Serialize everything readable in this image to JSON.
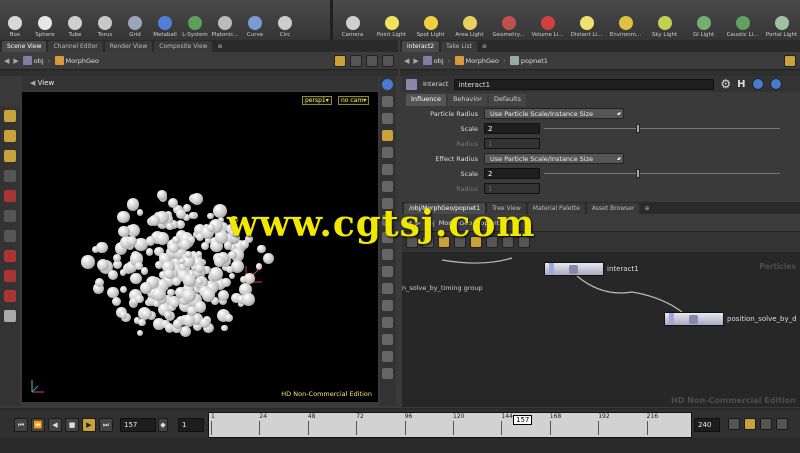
{
  "shelf_left": [
    {
      "label": "Box",
      "icon": "box-icon",
      "color": "#d8d8d8"
    },
    {
      "label": "Sphere",
      "icon": "sphere-icon",
      "color": "#e6e6e6"
    },
    {
      "label": "Tube",
      "icon": "tube-icon",
      "color": "#cfcfcf"
    },
    {
      "label": "Torus",
      "icon": "torus-icon",
      "color": "#c8c8c8"
    },
    {
      "label": "Grid",
      "icon": "grid-icon",
      "color": "#9aa6b8"
    },
    {
      "label": "Metaball",
      "icon": "metaball-icon",
      "color": "#4f7fd8"
    },
    {
      "label": "L-System",
      "icon": "lsystem-icon",
      "color": "#5aa05a"
    },
    {
      "label": "Platonic...",
      "icon": "platonic-icon",
      "color": "#bbbbbb"
    },
    {
      "label": "Curve",
      "icon": "curve-icon",
      "color": "#7a9ad0"
    },
    {
      "label": "Circ",
      "icon": "circle-icon",
      "color": "#cccccc"
    }
  ],
  "shelf_right": [
    {
      "label": "Camera",
      "icon": "camera-icon",
      "color": "#cfcfcf"
    },
    {
      "label": "Point Light",
      "icon": "point-light-icon",
      "color": "#f2e25c"
    },
    {
      "label": "Spot Light",
      "icon": "spot-light-icon",
      "color": "#f0d040"
    },
    {
      "label": "Area Light",
      "icon": "area-light-icon",
      "color": "#e8d060"
    },
    {
      "label": "Geometry...",
      "icon": "geometry-light-icon",
      "color": "#c05050"
    },
    {
      "label": "Volume Li...",
      "icon": "volume-light-icon",
      "color": "#d04040"
    },
    {
      "label": "Distant Li...",
      "icon": "distant-light-icon",
      "color": "#f0e070"
    },
    {
      "label": "Environm...",
      "icon": "environment-light-icon",
      "color": "#e0c040"
    },
    {
      "label": "Sky Light",
      "icon": "sky-light-icon",
      "color": "#c0d050"
    },
    {
      "label": "GI Light",
      "icon": "gi-light-icon",
      "color": "#70b070"
    },
    {
      "label": "Caustic Li...",
      "icon": "caustic-light-icon",
      "color": "#60a060"
    },
    {
      "label": "Portal Light",
      "icon": "portal-light-icon",
      "color": "#a0c0a0"
    }
  ],
  "left_pane": {
    "tabs": [
      "Scene View",
      "Channel Editor",
      "Render View",
      "Composite View"
    ],
    "path": {
      "root": "obj",
      "node": "MorphGeo"
    },
    "view_title": "View",
    "persp_label": "persp1▾",
    "cam_label": "no cam▾",
    "edition": "HD Non-Commercial Edition"
  },
  "param_pane": {
    "tabs": [
      "interact2",
      "Take List"
    ],
    "path": {
      "root": "obj",
      "node": "MorphGeo",
      "leaf": "popnet1"
    },
    "node_type": "Interact",
    "node_name": "interact1",
    "param_tabs": [
      "Influence",
      "Behavior",
      "Defaults"
    ],
    "rows": [
      {
        "label": "Particle Radius",
        "menu": "Use Particle Scale/Instance Size"
      },
      {
        "label": "Scale",
        "value": "2"
      },
      {
        "label": "Radius",
        "value": "1"
      },
      {
        "label": "Effect Radius",
        "menu": "Use Particle Scale/Instance Size"
      },
      {
        "label": "Scale",
        "value": "2"
      },
      {
        "label": "Radius",
        "value": "1"
      }
    ]
  },
  "net_pane": {
    "tabs": [
      "/obj/MorphGeo/popnet1",
      "Tree View",
      "Material Palette",
      "Asset Browser"
    ],
    "path": {
      "root": "obj",
      "node": "MorphGeo",
      "leaf": "popnet1"
    },
    "node_interact": "interact1",
    "node_position": "position_solve_by_d",
    "node_timing": "n_solve_by_timing group",
    "corner_label": "Particles",
    "edition": "HD Non-Commercial Edition"
  },
  "watermark": "www.cgtsj.com",
  "timeline": {
    "current_frame": "157",
    "step": "1",
    "end_frame": "240",
    "ticks": [
      "1",
      "24",
      "48",
      "72",
      "96",
      "120",
      "144",
      "168",
      "192",
      "216"
    ],
    "cursor": "157"
  }
}
